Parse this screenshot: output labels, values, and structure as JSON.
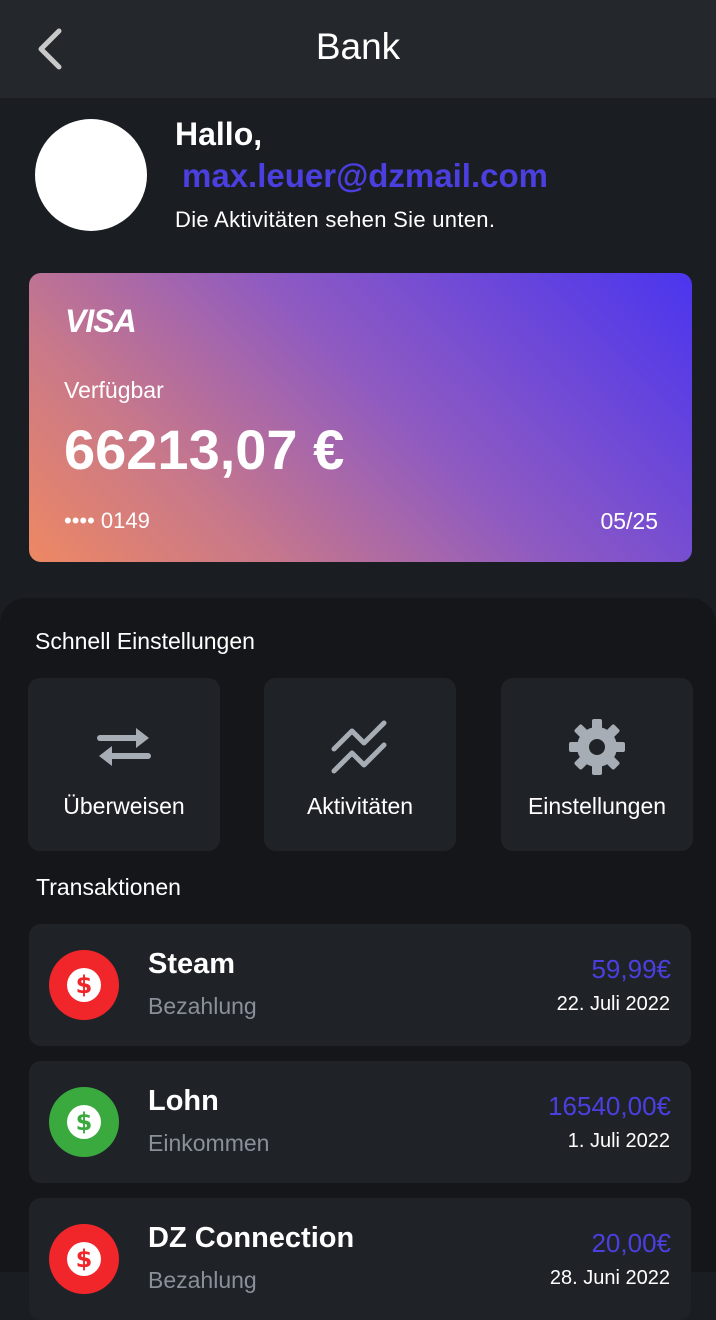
{
  "header": {
    "title": "Bank",
    "back_icon": "chevron-left-icon"
  },
  "profile": {
    "greeting": "Hallo,",
    "email": "max.leuer@dzmail.com",
    "subtitle": "Die Aktivitäten sehen Sie unten."
  },
  "card": {
    "brand": "VISA",
    "available_label": "Verfügbar",
    "balance": "66213,07 €",
    "number": "•••• 0149",
    "expiry": "05/25"
  },
  "quick_settings": {
    "title": "Schnell Einstellungen",
    "items": [
      {
        "label": "Überweisen",
        "icon": "transfer-arrows-icon"
      },
      {
        "label": "Aktivitäten",
        "icon": "trend-chart-icon"
      },
      {
        "label": "Einstellungen",
        "icon": "gear-icon"
      }
    ]
  },
  "transactions": {
    "title": "Transaktionen",
    "items": [
      {
        "name": "Steam",
        "type": "Bezahlung",
        "amount": "59,99€",
        "date": "22. Juli 2022",
        "icon": "dollar-icon",
        "icon_color": "#f0262a"
      },
      {
        "name": "Lohn",
        "type": "Einkommen",
        "amount": "16540,00€",
        "date": "1. Juli 2022",
        "icon": "dollar-icon",
        "icon_color": "#3aaa3f"
      },
      {
        "name": "DZ Connection",
        "type": "Bezahlung",
        "amount": "20,00€",
        "date": "28. Juni 2022",
        "icon": "dollar-icon",
        "icon_color": "#f0262a"
      }
    ]
  },
  "colors": {
    "accent": "#4b3fe0",
    "background": "#1a1e23",
    "panel": "#141619",
    "tile": "#1f2328",
    "expense": "#f0262a",
    "income": "#3aaa3f"
  }
}
